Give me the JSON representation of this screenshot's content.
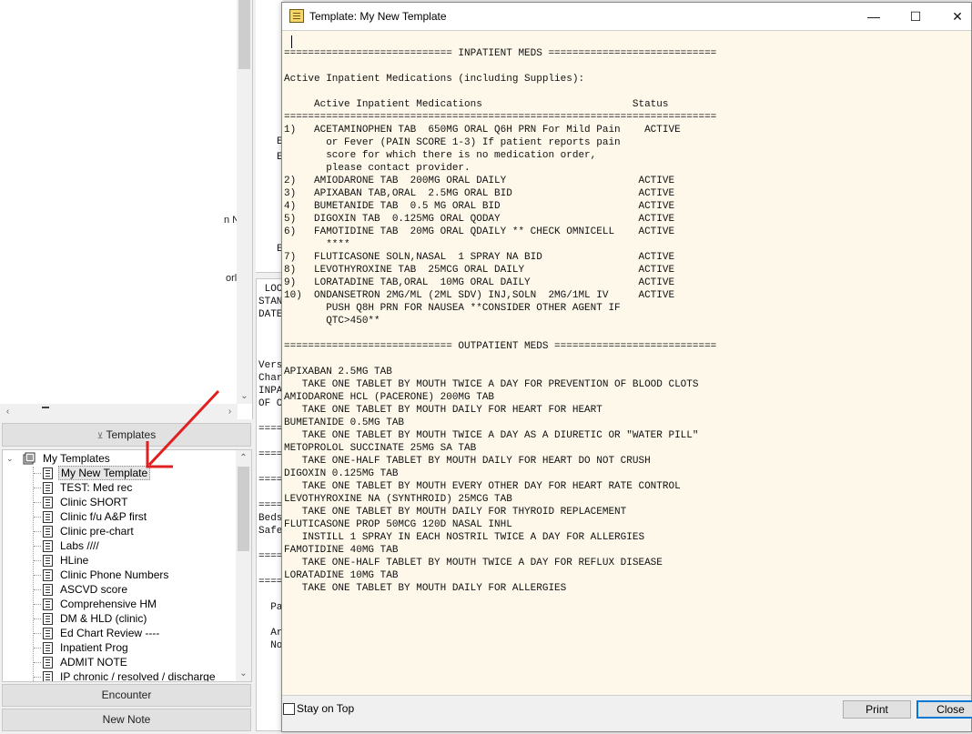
{
  "left_pane": {
    "fragments": [
      "n N",
      "orl"
    ],
    "templates_button": "Templates",
    "templates_arrow": "⊻",
    "tree": {
      "root": "My Templates",
      "items": [
        "My New Template",
        "TEST: Med rec",
        "Clinic SHORT",
        "Clinic f/u A&P first",
        "Clinic pre-chart",
        "Labs ////",
        "HLine",
        "Clinic Phone Numbers",
        "ASCVD score",
        "Comprehensive HM",
        "DM & HLD (clinic)",
        "Ed Chart Review ----",
        "Inpatient Prog",
        "ADMIT NOTE",
        "IP chronic / resolved / discharge"
      ],
      "selected_index": 0
    },
    "encounter_button": "Encounter",
    "new_note_button": "New Note"
  },
  "background_note": {
    "top_fragments": [
      "E",
      "E",
      "E"
    ],
    "bottom_text": " LOC\nSTAN\nDATE\n\n\n\nVers\nChar\nINPA\nOF C\n\n====\n\n====\n\n====\n\n====\nBeds\nSafe\n\n====\n\n====\n\n  Pa\n\n  Ar\n  No"
  },
  "dialog": {
    "title": "Template: My New Template",
    "window_buttons": {
      "minimize": "—",
      "maximize": "☐",
      "close": "✕"
    },
    "content_lines": [
      "============================ INPATIENT MEDS ============================",
      "",
      "Active Inpatient Medications (including Supplies):",
      "",
      "     Active Inpatient Medications                         Status",
      "========================================================================",
      "1)   ACETAMINOPHEN TAB  650MG ORAL Q6H PRN For Mild Pain    ACTIVE",
      "       or Fever (PAIN SCORE 1-3) If patient reports pain",
      "       score for which there is no medication order,",
      "       please contact provider.",
      "2)   AMIODARONE TAB  200MG ORAL DAILY                      ACTIVE",
      "3)   APIXABAN TAB,ORAL  2.5MG ORAL BID                     ACTIVE",
      "4)   BUMETANIDE TAB  0.5 MG ORAL BID                       ACTIVE",
      "5)   DIGOXIN TAB  0.125MG ORAL QODAY                       ACTIVE",
      "6)   FAMOTIDINE TAB  20MG ORAL QDAILY ** CHECK OMNICELL    ACTIVE",
      "       ****",
      "7)   FLUTICASONE SOLN,NASAL  1 SPRAY NA BID                ACTIVE",
      "8)   LEVOTHYROXINE TAB  25MCG ORAL DAILY                   ACTIVE",
      "9)   LORATADINE TAB,ORAL  10MG ORAL DAILY                  ACTIVE",
      "10)  ONDANSETRON 2MG/ML (2ML SDV) INJ,SOLN  2MG/1ML IV     ACTIVE",
      "       PUSH Q8H PRN FOR NAUSEA **CONSIDER OTHER AGENT IF",
      "       QTC>450**",
      "",
      "============================ OUTPATIENT MEDS ===========================",
      "",
      "APIXABAN 2.5MG TAB",
      "   TAKE ONE TABLET BY MOUTH TWICE A DAY FOR PREVENTION OF BLOOD CLOTS",
      "AMIODARONE HCL (PACERONE) 200MG TAB",
      "   TAKE ONE TABLET BY MOUTH DAILY FOR HEART FOR HEART",
      "BUMETANIDE 0.5MG TAB",
      "   TAKE ONE TABLET BY MOUTH TWICE A DAY AS A DIURETIC OR \"WATER PILL\"",
      "METOPROLOL SUCCINATE 25MG SA TAB",
      "   TAKE ONE-HALF TABLET BY MOUTH DAILY FOR HEART DO NOT CRUSH",
      "DIGOXIN 0.125MG TAB",
      "   TAKE ONE TABLET BY MOUTH EVERY OTHER DAY FOR HEART RATE CONTROL",
      "LEVOTHYROXINE NA (SYNTHROID) 25MCG TAB",
      "   TAKE ONE TABLET BY MOUTH DAILY FOR THYROID REPLACEMENT",
      "FLUTICASONE PROP 50MCG 120D NASAL INHL",
      "   INSTILL 1 SPRAY IN EACH NOSTRIL TWICE A DAY FOR ALLERGIES",
      "FAMOTIDINE 40MG TAB",
      "   TAKE ONE-HALF TABLET BY MOUTH TWICE A DAY FOR REFLUX DISEASE",
      "LORATADINE 10MG TAB",
      "   TAKE ONE TABLET BY MOUTH DAILY FOR ALLERGIES"
    ],
    "stay_on_top_label": "Stay on Top",
    "print_button": "Print",
    "close_button": "Close"
  },
  "colors": {
    "editor_background": "#fdf8ea",
    "annotation_arrow": "#e02020",
    "default_button_border": "#0078d7"
  }
}
